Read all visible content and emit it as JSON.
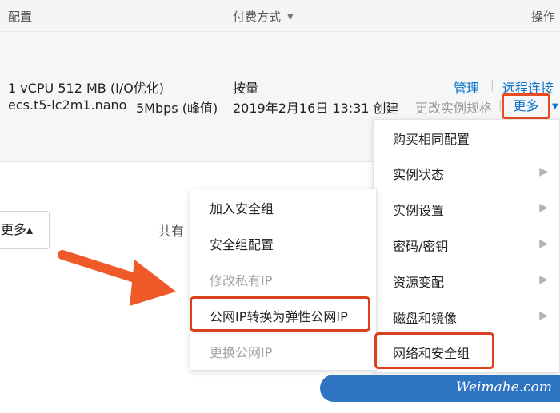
{
  "table_header": {
    "config": "配置",
    "payment": "付费方式",
    "operations": "操作"
  },
  "instance": {
    "spec": "1 vCPU 512 MB (I/O优化)",
    "type": "ecs.t5-lc2m1.nano",
    "bandwidth": "5Mbps (峰值)",
    "billing": "按量",
    "created": "2019年2月16日 13:31 创建",
    "actions": {
      "manage": "管理",
      "separator": "|",
      "remote": "远程连接",
      "resize": "更改实例规格",
      "more": "更多"
    }
  },
  "bottom_bar": {
    "more_label": "更多▴",
    "total_label": "共有"
  },
  "main_menu": {
    "items": [
      {
        "label": "购买相同配置",
        "has_submenu": false
      },
      {
        "label": "实例状态",
        "has_submenu": true
      },
      {
        "label": "实例设置",
        "has_submenu": true
      },
      {
        "label": "密码/密钥",
        "has_submenu": true
      },
      {
        "label": "资源变配",
        "has_submenu": true
      },
      {
        "label": "磁盘和镜像",
        "has_submenu": true
      },
      {
        "label": "网络和安全组",
        "has_submenu": false
      }
    ]
  },
  "network_submenu": {
    "items": [
      {
        "label": "加入安全组",
        "disabled": false
      },
      {
        "label": "安全组配置",
        "disabled": false
      },
      {
        "label": "修改私有IP",
        "disabled": true
      },
      {
        "label": "公网IP转换为弹性公网IP",
        "disabled": false
      },
      {
        "label": "更换公网IP",
        "disabled": true
      }
    ]
  },
  "watermark": "Weimahe.com",
  "colors": {
    "link": "#0b72c9",
    "highlight": "#e84b20",
    "watermark_bg": "#2f74c0"
  }
}
